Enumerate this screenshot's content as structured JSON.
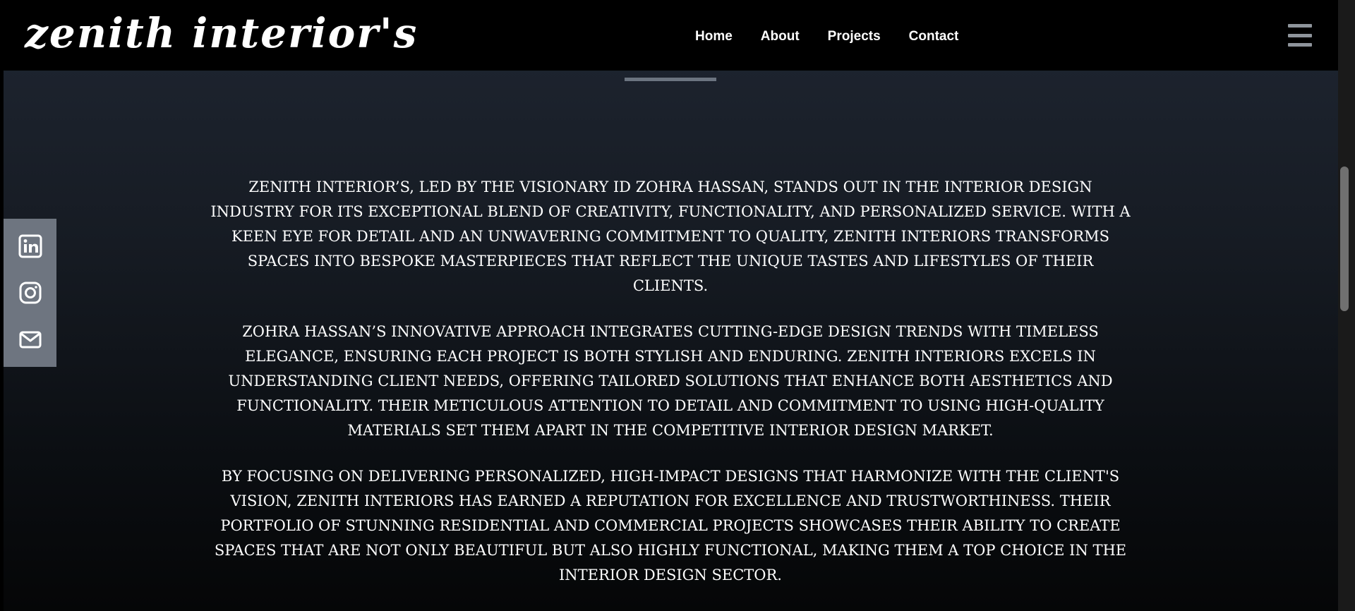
{
  "brand": {
    "name": "zenith interior's"
  },
  "nav": {
    "links": [
      {
        "label": "Home"
      },
      {
        "label": "About"
      },
      {
        "label": "Projects"
      },
      {
        "label": "Contact"
      }
    ],
    "menu_icon": "hamburger-icon"
  },
  "social": {
    "icons": [
      "linkedin-icon",
      "instagram-icon",
      "mail-icon"
    ],
    "bar_color": "#6e7580"
  },
  "content": {
    "paragraphs": [
      "ZENITH INTERIOR’S, LED BY THE VISIONARY ID ZOHRA HASSAN, STANDS OUT IN THE INTERIOR DESIGN INDUSTRY FOR ITS EXCEPTIONAL BLEND OF CREATIVITY, FUNCTIONALITY, AND PERSONALIZED SERVICE. WITH A KEEN EYE FOR DETAIL AND AN UNWAVERING COMMITMENT TO QUALITY, ZENITH INTERIORS TRANSFORMS SPACES INTO BESPOKE MASTERPIECES THAT REFLECT THE UNIQUE TASTES AND LIFESTYLES OF THEIR CLIENTS.",
      "ZOHRA HASSAN’S INNOVATIVE APPROACH INTEGRATES CUTTING-EDGE DESIGN TRENDS WITH TIMELESS ELEGANCE, ENSURING EACH PROJECT IS BOTH STYLISH AND ENDURING. ZENITH INTERIORS EXCELS IN UNDERSTANDING CLIENT NEEDS, OFFERING TAILORED SOLUTIONS THAT ENHANCE BOTH AESTHETICS AND FUNCTIONALITY. THEIR METICULOUS ATTENTION TO DETAIL AND COMMITMENT TO USING HIGH-QUALITY MATERIALS SET THEM APART IN THE COMPETITIVE INTERIOR DESIGN MARKET.",
      "BY FOCUSING ON DELIVERING PERSONALIZED, HIGH-IMPACT DESIGNS THAT HARMONIZE WITH THE CLIENT'S VISION, ZENITH INTERIORS HAS EARNED A REPUTATION FOR EXCELLENCE AND TRUSTWORTHINESS. THEIR PORTFOLIO OF STUNNING RESIDENTIAL AND COMMERCIAL PROJECTS SHOWCASES THEIR ABILITY TO CREATE SPACES THAT ARE NOT ONLY BEAUTIFUL BUT ALSO HIGHLY FUNCTIONAL, MAKING THEM A TOP CHOICE IN THE INTERIOR DESIGN SECTOR."
    ]
  },
  "colors": {
    "navbar": "#000000",
    "text": "#ffffff",
    "accent_line": "#6b7480"
  }
}
